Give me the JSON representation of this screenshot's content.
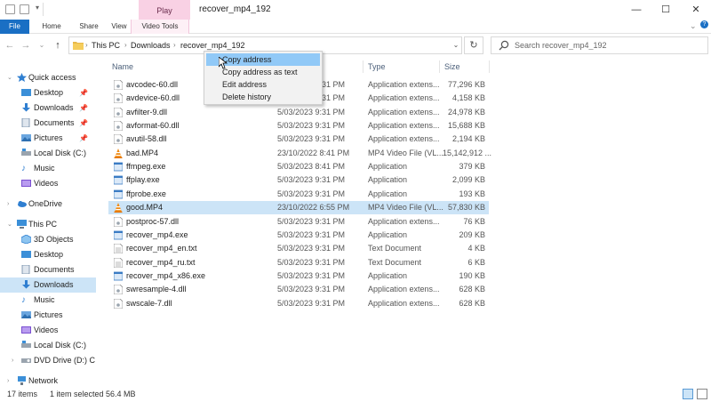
{
  "titlebar": {
    "play_tab": "Play",
    "title": "recover_mp4_192",
    "minimize": "—",
    "maximize": "☐",
    "close": "✕"
  },
  "ribbon": {
    "tabs": [
      "File",
      "Home",
      "Share",
      "View",
      "Video Tools"
    ]
  },
  "address": {
    "back": "←",
    "forward": "→",
    "recent": "⌄",
    "up": "↑",
    "crumbs": [
      "This PC",
      "Downloads",
      "recover_mp4_192"
    ],
    "dropdown": "⌄",
    "refresh": "↻"
  },
  "search": {
    "placeholder": "Search recover_mp4_192"
  },
  "nav": {
    "quick_access": "Quick access",
    "qa_items": [
      "Desktop",
      "Downloads",
      "Documents",
      "Pictures",
      "Local Disk (C:)",
      "Music",
      "Videos"
    ],
    "onedrive": "OneDrive",
    "this_pc": "This PC",
    "pc_items": [
      "3D Objects",
      "Desktop",
      "Documents",
      "Downloads",
      "Music",
      "Pictures",
      "Videos",
      "Local Disk (C:)",
      "DVD Drive (D:) C"
    ],
    "network": "Network"
  },
  "columns": {
    "name": "Name",
    "date": "Date modified",
    "date_visible": "d",
    "type": "Type",
    "size": "Size"
  },
  "files": [
    {
      "name": "avcodec-60.dll",
      "date": "5/03/2023 9:31 PM",
      "type": "Application extens...",
      "size": "77,296 KB",
      "icon": "dll"
    },
    {
      "name": "avdevice-60.dll",
      "date": "5/03/2023 9:31 PM",
      "type": "Application extens...",
      "size": "4,158 KB",
      "icon": "dll"
    },
    {
      "name": "avfilter-9.dll",
      "date": "5/03/2023 9:31 PM",
      "type": "Application extens...",
      "size": "24,978 KB",
      "icon": "dll"
    },
    {
      "name": "avformat-60.dll",
      "date": "5/03/2023 9:31 PM",
      "type": "Application extens...",
      "size": "15,688 KB",
      "icon": "dll"
    },
    {
      "name": "avutil-58.dll",
      "date": "5/03/2023 9:31 PM",
      "type": "Application extens...",
      "size": "2,194 KB",
      "icon": "dll"
    },
    {
      "name": "bad.MP4",
      "date": "23/10/2022 8:41 PM",
      "type": "MP4 Video File (VL...",
      "size": "15,142,912 ...",
      "icon": "vlc"
    },
    {
      "name": "ffmpeg.exe",
      "date": "5/03/2023 8:41 PM",
      "type": "Application",
      "size": "379 KB",
      "icon": "exe"
    },
    {
      "name": "ffplay.exe",
      "date": "5/03/2023 9:31 PM",
      "type": "Application",
      "size": "2,099 KB",
      "icon": "exe"
    },
    {
      "name": "ffprobe.exe",
      "date": "5/03/2023 9:31 PM",
      "type": "Application",
      "size": "193 KB",
      "icon": "exe"
    },
    {
      "name": "good.MP4",
      "date": "23/10/2022 6:55 PM",
      "type": "MP4 Video File (VL...",
      "size": "57,830 KB",
      "icon": "vlc",
      "selected": true
    },
    {
      "name": "postproc-57.dll",
      "date": "5/03/2023 9:31 PM",
      "type": "Application extens...",
      "size": "76 KB",
      "icon": "dll"
    },
    {
      "name": "recover_mp4.exe",
      "date": "5/03/2023 9:31 PM",
      "type": "Application",
      "size": "209 KB",
      "icon": "exe"
    },
    {
      "name": "recover_mp4_en.txt",
      "date": "5/03/2023 9:31 PM",
      "type": "Text Document",
      "size": "4 KB",
      "icon": "txt"
    },
    {
      "name": "recover_mp4_ru.txt",
      "date": "5/03/2023 9:31 PM",
      "type": "Text Document",
      "size": "6 KB",
      "icon": "txt"
    },
    {
      "name": "recover_mp4_x86.exe",
      "date": "5/03/2023 9:31 PM",
      "type": "Application",
      "size": "190 KB",
      "icon": "exe"
    },
    {
      "name": "swresample-4.dll",
      "date": "5/03/2023 9:31 PM",
      "type": "Application extens...",
      "size": "628 KB",
      "icon": "dll"
    },
    {
      "name": "swscale-7.dll",
      "date": "5/03/2023 9:31 PM",
      "type": "Application extens...",
      "size": "628 KB",
      "icon": "dll"
    }
  ],
  "context_menu": {
    "items": [
      "Copy address",
      "Copy address as text",
      "Edit address",
      "Delete history"
    ],
    "hovered": 0
  },
  "status": {
    "items": "17 items",
    "selected": "1 item selected",
    "size": "56.4 MB"
  },
  "colors": {
    "accent": "#1a6fc4",
    "selection": "#cce4f7",
    "menu_hover": "#91c9f7",
    "video_tools": "#f9d1e4"
  }
}
